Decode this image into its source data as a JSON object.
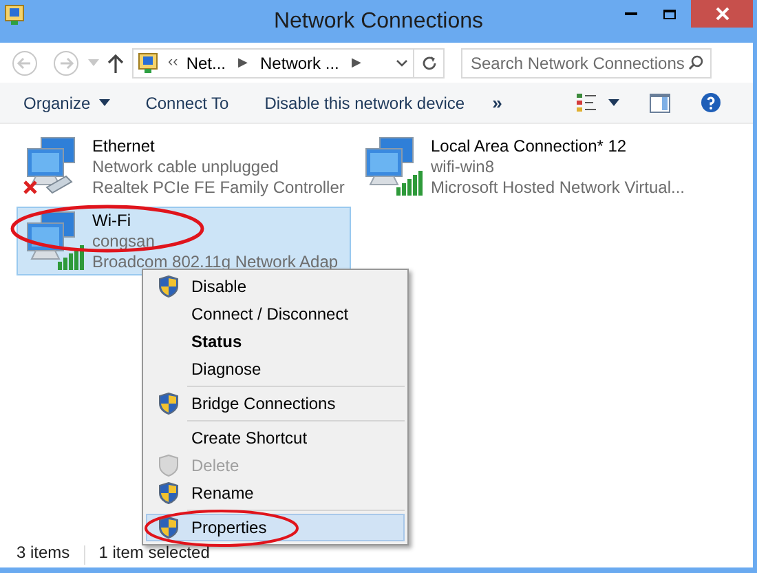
{
  "window": {
    "title": "Network Connections"
  },
  "address": {
    "overflow": "‹‹",
    "crumbs": [
      "Net...",
      "Network ..."
    ],
    "separator": "▶"
  },
  "search": {
    "placeholder": "Search Network Connections"
  },
  "toolbar": {
    "items": [
      {
        "label": "Organize",
        "dropdown": true
      },
      {
        "label": "Connect To",
        "dropdown": false
      },
      {
        "label": "Disable this network device",
        "dropdown": false
      }
    ],
    "more": "»"
  },
  "connections": [
    {
      "name": "Ethernet",
      "status": "Network cable unplugged",
      "device": "Realtek PCIe FE Family Controller",
      "kind": "wired",
      "selected": false,
      "circled": false
    },
    {
      "name": "Local Area Connection* 12",
      "status": "wifi-win8",
      "device": "Microsoft Hosted Network Virtual...",
      "kind": "wireless",
      "selected": false,
      "circled": false
    },
    {
      "name": "Wi-Fi",
      "status": "congsan",
      "device": "Broadcom 802.11g Network Adap",
      "kind": "wireless",
      "selected": true,
      "circled": true
    }
  ],
  "context_menu": [
    {
      "kind": "item",
      "label": "Disable",
      "shield": true,
      "bold": false,
      "disabled": false,
      "selected": false,
      "circled": false
    },
    {
      "kind": "item",
      "label": "Connect / Disconnect",
      "shield": false,
      "bold": false,
      "disabled": false,
      "selected": false,
      "circled": false
    },
    {
      "kind": "item",
      "label": "Status",
      "shield": false,
      "bold": true,
      "disabled": false,
      "selected": false,
      "circled": false
    },
    {
      "kind": "item",
      "label": "Diagnose",
      "shield": false,
      "bold": false,
      "disabled": false,
      "selected": false,
      "circled": false
    },
    {
      "kind": "separator"
    },
    {
      "kind": "item",
      "label": "Bridge Connections",
      "shield": true,
      "bold": false,
      "disabled": false,
      "selected": false,
      "circled": false
    },
    {
      "kind": "separator"
    },
    {
      "kind": "item",
      "label": "Create Shortcut",
      "shield": false,
      "bold": false,
      "disabled": false,
      "selected": false,
      "circled": false
    },
    {
      "kind": "item",
      "label": "Delete",
      "shield": true,
      "bold": false,
      "disabled": true,
      "selected": false,
      "circled": false
    },
    {
      "kind": "item",
      "label": "Rename",
      "shield": true,
      "bold": false,
      "disabled": false,
      "selected": false,
      "circled": false
    },
    {
      "kind": "separator"
    },
    {
      "kind": "item",
      "label": "Properties",
      "shield": true,
      "bold": false,
      "disabled": false,
      "selected": true,
      "circled": true
    }
  ],
  "status_bar": {
    "count": "3 items",
    "selection": "1 item selected"
  }
}
